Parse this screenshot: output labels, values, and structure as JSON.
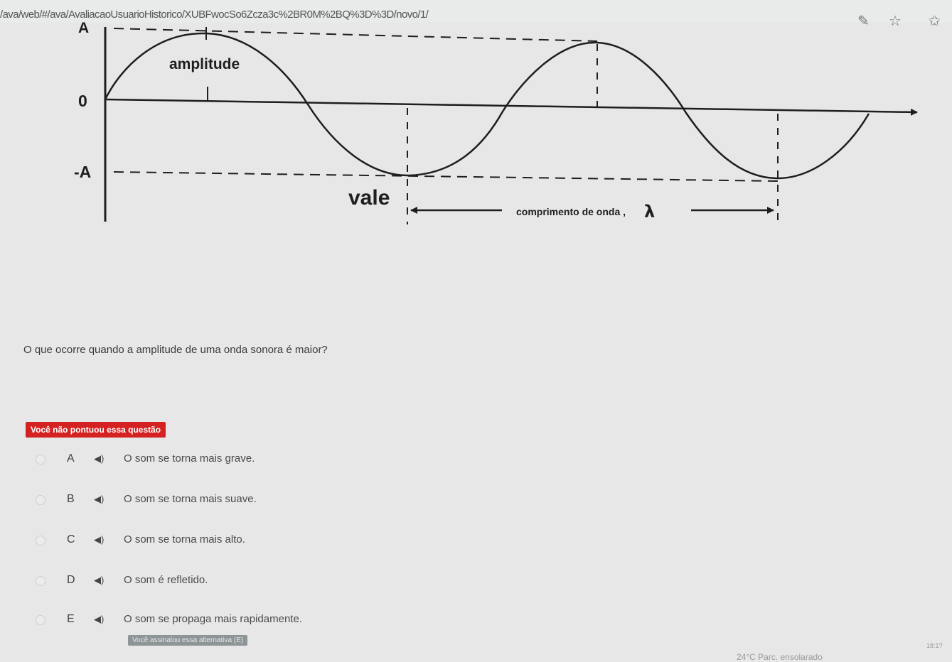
{
  "browser": {
    "url": "/ava/web/#/ava/AvaliacaoUsuarioHistorico/XUBFwocSo6Zcza3c%2BR0M%2BQ%3D%3D/novo/1/",
    "icons": [
      "edit-icon",
      "star-icon",
      "favorites-icon"
    ]
  },
  "figure": {
    "label_A": "A",
    "label_zero": "0",
    "label_minus_A": "-A",
    "label_amplitude": "amplitude",
    "label_vale": "vale",
    "label_wavelength": "comprimento de onda ,",
    "label_lambda": "λ"
  },
  "question": {
    "text": "O que ocorre quando a amplitude de uma onda sonora é maior?",
    "result_badge": "Você não pontuou essa questão",
    "options": [
      {
        "letter": "A",
        "text": "O som se torna mais grave."
      },
      {
        "letter": "B",
        "text": "O som se torna mais suave."
      },
      {
        "letter": "C",
        "text": "O som se torna mais alto."
      },
      {
        "letter": "D",
        "text": "O som é refletido."
      },
      {
        "letter": "E",
        "text": "O som se propaga mais rapidamente."
      }
    ],
    "answer_tag": "Você assinalou essa alternativa (E)"
  },
  "taskbar": {
    "weather": "24°C  Parc. ensolarado",
    "clock": "18:1?"
  },
  "colors": {
    "badge": "#d42222",
    "answer_tag": "#8d9597",
    "background": "#e6e7e6"
  }
}
